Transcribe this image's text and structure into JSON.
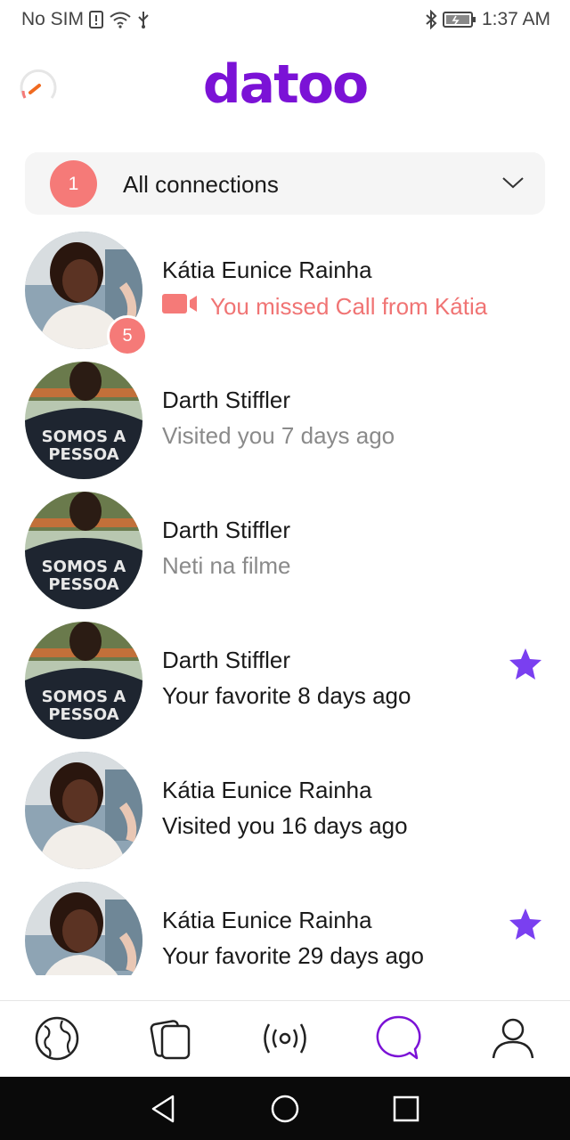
{
  "status_bar": {
    "carrier": "No SIM",
    "time": "1:37 AM"
  },
  "header": {
    "logo": "datoo",
    "accent_color": "#7b12d6"
  },
  "filter": {
    "badge_count": "1",
    "label": "All connections"
  },
  "connections": [
    {
      "name": "Kátia Eunice Rainha",
      "subtitle": "You missed Call from Kátia",
      "badge": "5",
      "subtitle_style": "missed",
      "icon": "video-icon",
      "favorite": false
    },
    {
      "name": "Darth Stiffler",
      "subtitle": "Visited you 7 days ago",
      "subtitle_style": "gray",
      "favorite": false
    },
    {
      "name": "Darth Stiffler",
      "subtitle": "Neti na filme",
      "subtitle_style": "gray",
      "favorite": false
    },
    {
      "name": "Darth Stiffler",
      "subtitle": "Your favorite 8 days ago",
      "subtitle_style": "dark",
      "favorite": true
    },
    {
      "name": "Kátia Eunice Rainha",
      "subtitle": "Visited you 16 days ago",
      "subtitle_style": "dark",
      "favorite": false
    },
    {
      "name": "Kátia Eunice Rainha",
      "subtitle": "Your favorite 29 days ago",
      "subtitle_style": "dark",
      "favorite": true
    }
  ],
  "tabs": [
    {
      "icon": "globe-icon",
      "active": false
    },
    {
      "icon": "cards-icon",
      "active": false
    },
    {
      "icon": "broadcast-icon",
      "active": false
    },
    {
      "icon": "chat-icon",
      "active": true
    },
    {
      "icon": "profile-icon",
      "active": false
    }
  ],
  "colors": {
    "badge": "#f57a78",
    "missed_text": "#f07474",
    "star": "#7a3ff0",
    "inactive_icon": "#222222"
  }
}
